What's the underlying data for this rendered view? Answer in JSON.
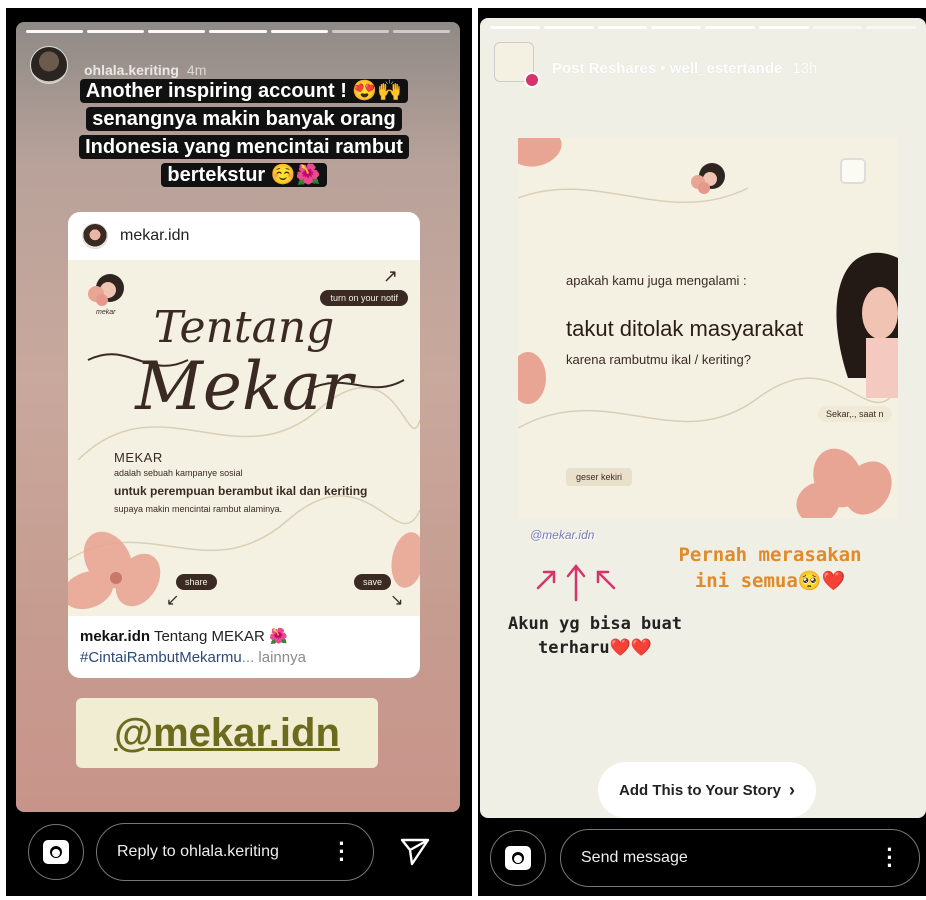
{
  "left_story": {
    "username": "ohlala.keriting",
    "time": "4m",
    "caption_lines": [
      "Another inspiring account ! 😍🙌",
      "senangnya makin banyak orang",
      "Indonesia yang mencintai rambut",
      "bertekstur ☺️🌺"
    ],
    "post": {
      "handle": "mekar.idn",
      "image": {
        "notif_label": "turn on your notif",
        "title_top": "Tentang",
        "title_main": "Mekar",
        "heading": "MEKAR",
        "line1": "adalah sebuah kampanye sosial",
        "line2": "untuk perempuan berambut ikal dan keriting",
        "line3": "supaya makin mencintai rambut alaminya.",
        "share_label": "share",
        "save_label": "save"
      },
      "caption_user": "mekar.idn",
      "caption_text": "Tentang MEKAR 🌺",
      "hashtag": "#CintaiRambutMekarmu",
      "ellipsis": "...",
      "more": "lainnya"
    },
    "mention": "@mekar.idn",
    "reply_placeholder": "Reply to ohlala.keriting"
  },
  "right_story": {
    "header": "Post Reshares • well_estertande",
    "time": "13h",
    "card": {
      "question_intro": "apakah kamu juga mengalami :",
      "question_main": "takut ditolak masyarakat",
      "question_sub": "karena rambutmu ikal / keriting?",
      "sekar_label": "Sekar,., saat n",
      "swipe_label": "geser kekiri"
    },
    "handle_sticker": "@mekar.idn",
    "pernah_line1": "Pernah merasakan",
    "pernah_line2": "ini semua🥺❤️",
    "akun_line1": "Akun yg bisa buat",
    "akun_line2": "terharu❤️❤️",
    "add_story_label": "Add This to Your Story",
    "message_placeholder": "Send message"
  },
  "colors": {
    "brand_brown": "#3b2a23",
    "mention_olive": "#6b6a1d",
    "pernah_orange": "#e08a28",
    "arrow_pink": "#d6336c"
  }
}
